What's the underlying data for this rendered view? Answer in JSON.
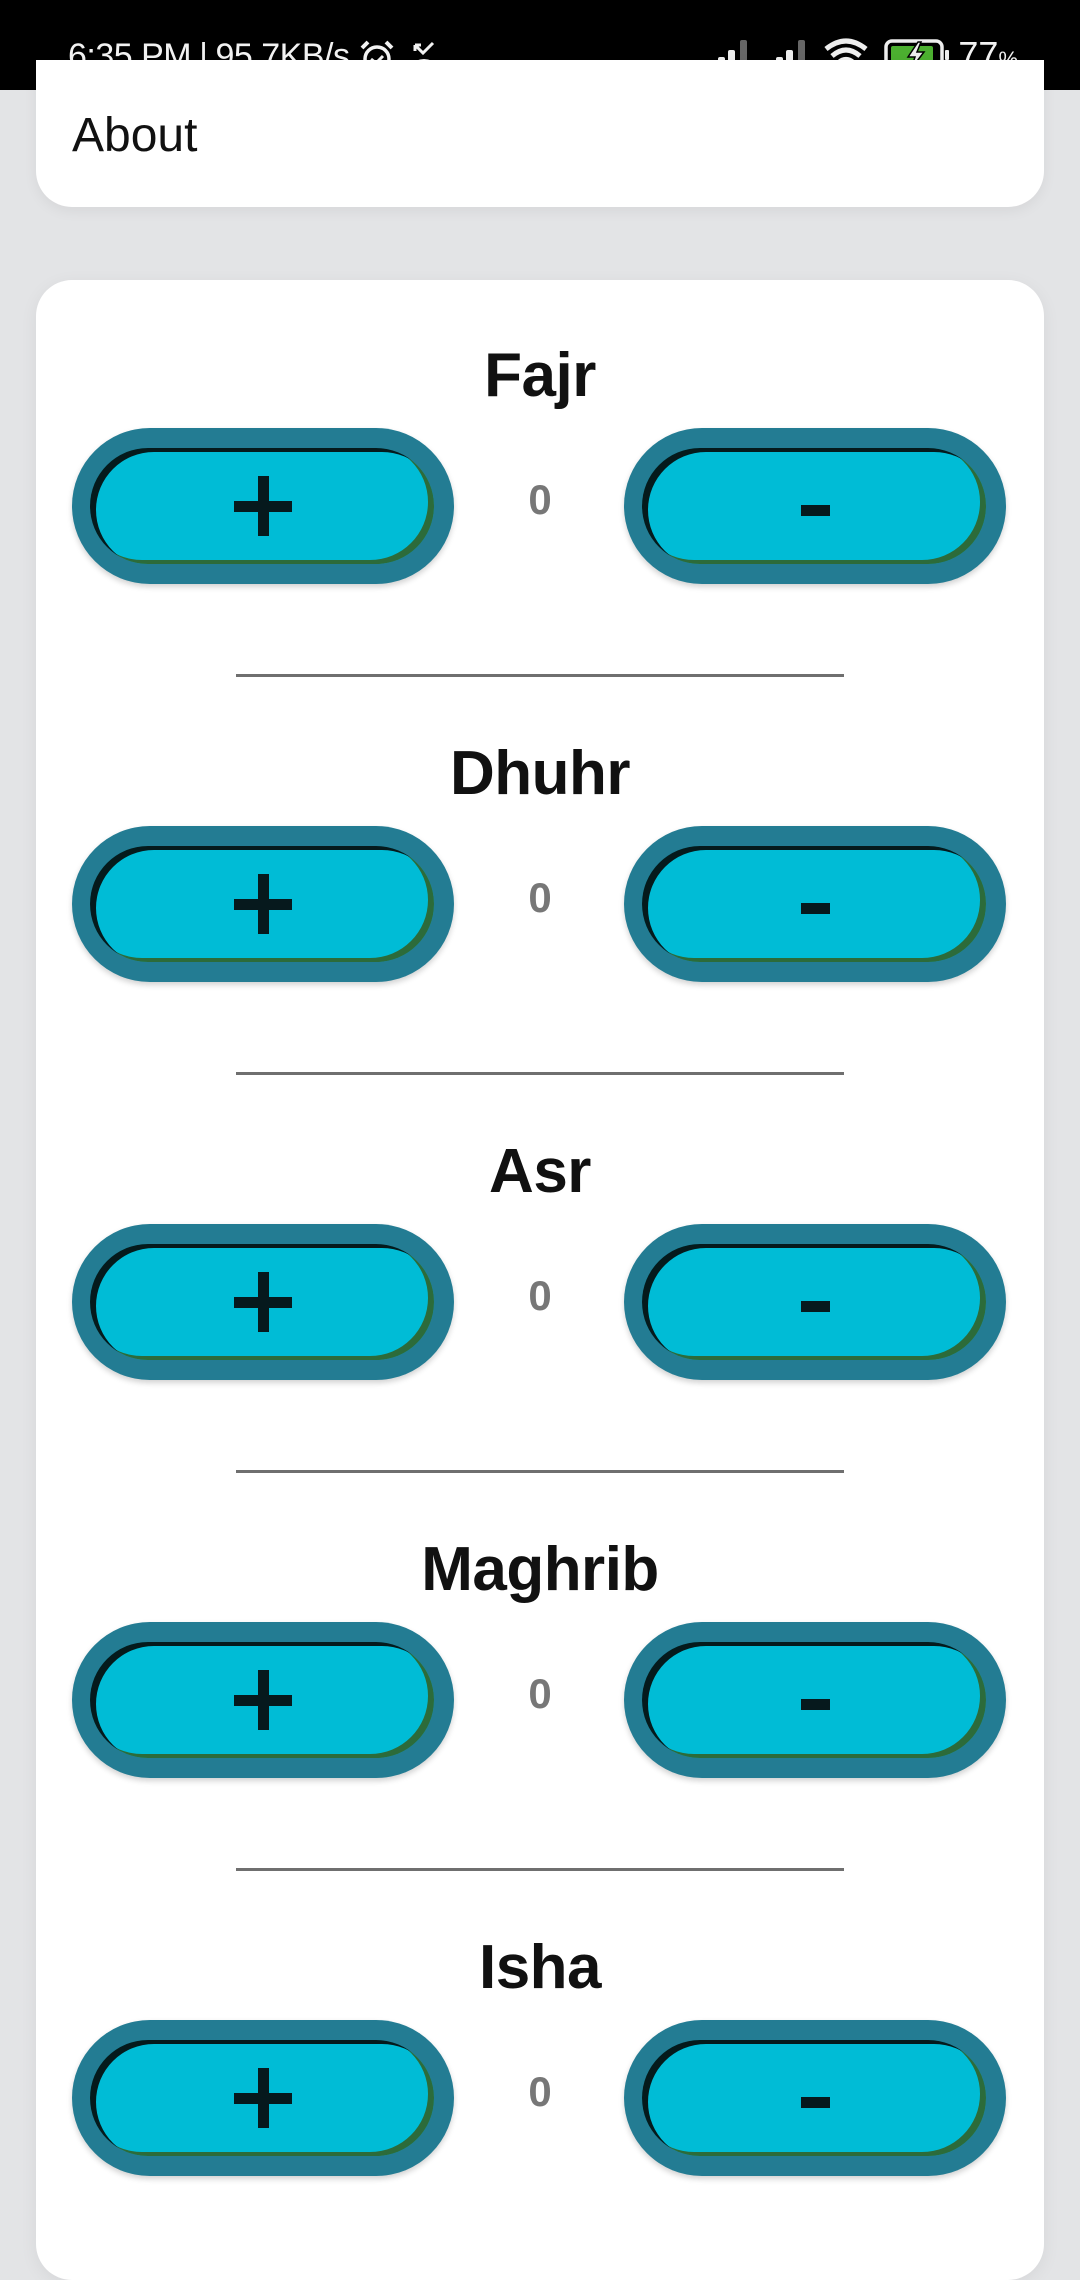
{
  "status_bar": {
    "time": "6:35 PM",
    "separator": "|",
    "network_speed": "95.7KB/s",
    "left_icons": [
      "alarm-icon",
      "missed-call-icon"
    ],
    "right_icons": [
      "signal-sim1-icon",
      "signal-sim2-icon",
      "wifi-icon",
      "battery-charging-icon"
    ],
    "battery_percent": "77",
    "battery_unit": "%",
    "battery_color": "#4cb030"
  },
  "about": {
    "label": "About"
  },
  "prayers": [
    {
      "name": "Fajr",
      "count": "0",
      "plus_label": "+",
      "minus_label": "-"
    },
    {
      "name": "Dhuhr",
      "count": "0",
      "plus_label": "+",
      "minus_label": "-"
    },
    {
      "name": "Asr",
      "count": "0",
      "plus_label": "+",
      "minus_label": "-"
    },
    {
      "name": "Maghrib",
      "count": "0",
      "plus_label": "+",
      "minus_label": "-"
    },
    {
      "name": "Isha",
      "count": "0",
      "plus_label": "+",
      "minus_label": "-"
    }
  ],
  "colors": {
    "button_outer": "#237c93",
    "button_inner": "#00bcd6",
    "count_text": "#777777",
    "divider": "#6f6f6f",
    "background": "#e3e4e6"
  }
}
